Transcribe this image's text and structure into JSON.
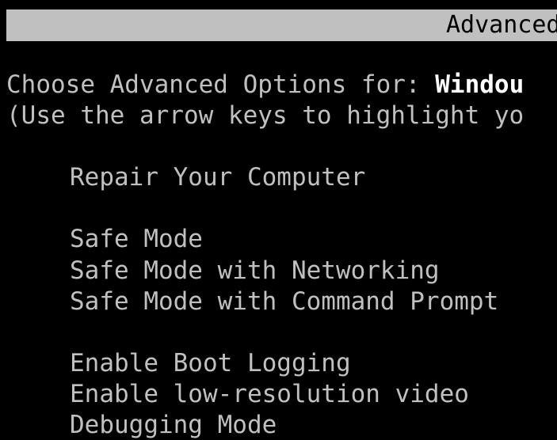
{
  "title_bar": {
    "label": "Advanced"
  },
  "header": {
    "prompt_prefix": "Choose Advanced Options for: ",
    "os_name": "Windou",
    "instruction": "(Use the arrow keys to highlight yo"
  },
  "menu": {
    "items": [
      "Repair Your Computer",
      "Safe Mode",
      "Safe Mode with Networking",
      "Safe Mode with Command Prompt",
      "Enable Boot Logging",
      "Enable low-resolution video",
      "Debugging Mode"
    ]
  },
  "colors": {
    "background": "#000000",
    "text": "#c0c0c0",
    "highlight_text": "#ffffff",
    "title_bar": "#c0c0c0"
  }
}
